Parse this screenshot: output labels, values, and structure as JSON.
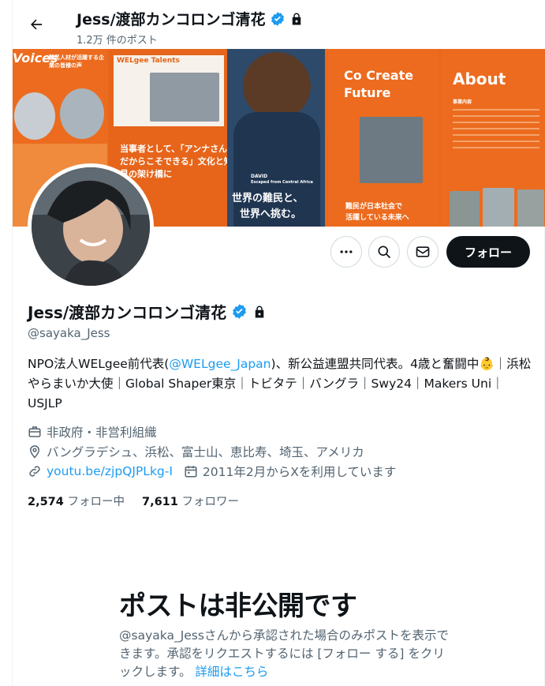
{
  "header": {
    "name": "Jess/渡部カンコロンゴ清花",
    "post_count": "1.2万 件のポスト"
  },
  "banner": {
    "panel1_title": "Voices",
    "panel1_sub": "難民人材が活躍する企業の皆様の声",
    "panel2_brand": "WELgee Talents",
    "panel2_caption1": "当事者として、「アンナさん",
    "panel2_caption2": "だからこそできる」文化と知",
    "panel2_caption3": "見の架け橋に",
    "panel3_name": "DAVID",
    "panel3_info": "Escaped from Central Africa",
    "panel3_big1": "世界の難民と、",
    "panel3_big2": "世界へ挑む。",
    "panel4_title1": "Co Create",
    "panel4_title2": "Future",
    "panel4_caption1": "難民が日本社会で",
    "panel4_caption2": "活躍している未来へ",
    "panel5_title": "About",
    "panel5_sub": "事業内容"
  },
  "profile": {
    "name": "Jess/渡部カンコロンゴ清花",
    "handle": "@sayaka_Jess",
    "follow_label": "フォロー"
  },
  "bio": {
    "part1": "NPO法人WELgee前代表(",
    "mention": "@WELgee_Japan",
    "part2": ")、新公益連盟共同代表。4歳と奮闘中",
    "emoji": "👶",
    "part3": "｜浜松やらまいか大使｜Global Shaper東京｜トビタテ｜バングラ｜Swy24｜Makers Uni｜USJLP"
  },
  "meta": {
    "category": "非政府・非営利組織",
    "location": "バングラデシュ、浜松、富士山、恵比寿、埼玉、アメリカ",
    "link": "youtu.be/zjpQJPLkg-I",
    "joined": "2011年2月からXを利用しています"
  },
  "counts": {
    "following_num": "2,574",
    "following_label": "フォロー中",
    "followers_num": "7,611",
    "followers_label": "フォロワー"
  },
  "private": {
    "title": "ポストは非公開です",
    "text": "@sayaka_Jessさんから承認された場合のみポストを表示できます。承認をリクエストするには [フォロー する] をクリックします。",
    "link": "詳細はこちら"
  },
  "colors": {
    "accent": "#1d9bf0",
    "banner_orange": "#ea6a1c",
    "text_primary": "#0f1419",
    "text_secondary": "#536471"
  }
}
